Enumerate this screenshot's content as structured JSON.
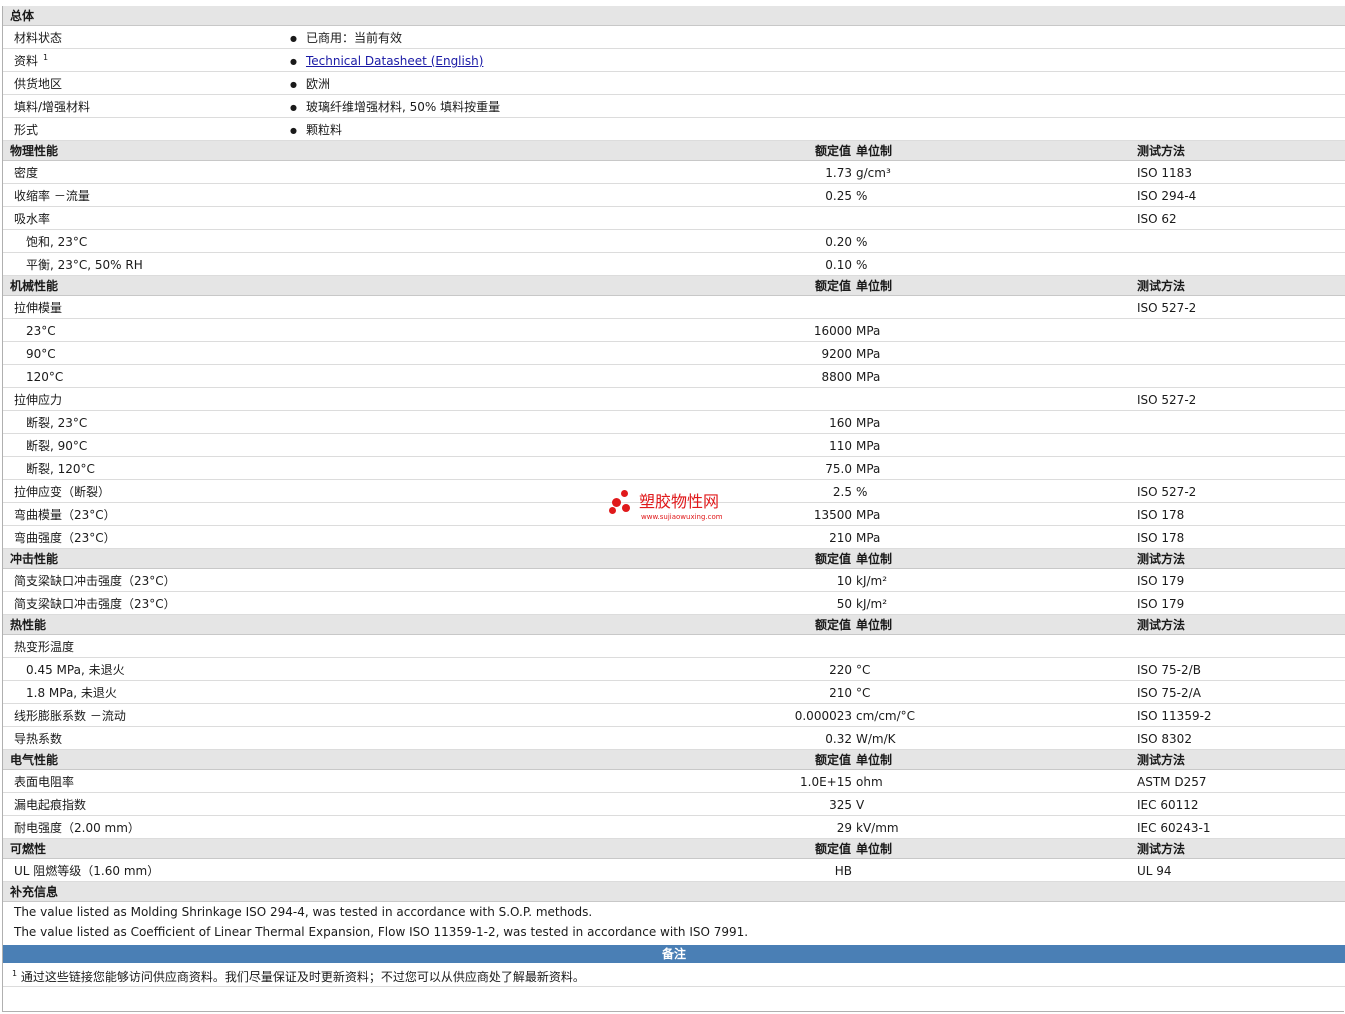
{
  "general": {
    "title": "总体",
    "rows": [
      {
        "label": "材料状态",
        "value": "已商用：当前有效"
      },
      {
        "label": "资料",
        "sup": "1",
        "value": "Technical Datasheet (English)",
        "is_link": true
      },
      {
        "label": "供货地区",
        "value": "欧洲"
      },
      {
        "label": "填料/增强材料",
        "value": "玻璃纤维增强材料, 50% 填料按重量"
      },
      {
        "label": "形式",
        "value": "颗粒料"
      }
    ]
  },
  "column_headers": {
    "value": "额定值",
    "unit": "单位制",
    "method": "测试方法"
  },
  "sections": [
    {
      "title": "物理性能",
      "rows": [
        {
          "label": "密度",
          "value": "1.73",
          "unit": "g/cm³",
          "method": "ISO 1183"
        },
        {
          "label": "收缩率 －流量",
          "value": "0.25",
          "unit": "%",
          "method": "ISO 294-4"
        },
        {
          "label": "吸水率",
          "method": "ISO 62"
        },
        {
          "label": "饱和, 23°C",
          "sub": true,
          "value": "0.20",
          "unit": "%"
        },
        {
          "label": "平衡, 23°C, 50% RH",
          "sub": true,
          "value": "0.10",
          "unit": "%"
        }
      ]
    },
    {
      "title": "机械性能",
      "rows": [
        {
          "label": "拉伸模量",
          "method": "ISO 527-2"
        },
        {
          "label": "23°C",
          "sub": true,
          "value": "16000",
          "unit": "MPa"
        },
        {
          "label": "90°C",
          "sub": true,
          "value": "9200",
          "unit": "MPa"
        },
        {
          "label": "120°C",
          "sub": true,
          "value": "8800",
          "unit": "MPa"
        },
        {
          "label": "拉伸应力",
          "method": "ISO 527-2"
        },
        {
          "label": "断裂, 23°C",
          "sub": true,
          "value": "160",
          "unit": "MPa"
        },
        {
          "label": "断裂, 90°C",
          "sub": true,
          "value": "110",
          "unit": "MPa"
        },
        {
          "label": "断裂, 120°C",
          "sub": true,
          "value": "75.0",
          "unit": "MPa"
        },
        {
          "label": "拉伸应变（断裂）",
          "value": "2.5",
          "unit": "%",
          "method": "ISO 527-2"
        },
        {
          "label": "弯曲模量（23°C）",
          "value": "13500",
          "unit": "MPa",
          "method": "ISO 178"
        },
        {
          "label": "弯曲强度（23°C）",
          "value": "210",
          "unit": "MPa",
          "method": "ISO 178"
        }
      ]
    },
    {
      "title": "冲击性能",
      "rows": [
        {
          "label": "简支梁缺口冲击强度（23°C）",
          "value": "10",
          "unit": "kJ/m²",
          "method": "ISO 179"
        },
        {
          "label": "简支梁缺口冲击强度（23°C）",
          "value": "50",
          "unit": "kJ/m²",
          "method": "ISO 179"
        }
      ]
    },
    {
      "title": "热性能",
      "rows": [
        {
          "label": "热变形温度"
        },
        {
          "label": "0.45 MPa, 未退火",
          "sub": true,
          "value": "220",
          "unit": "°C",
          "method": "ISO 75-2/B"
        },
        {
          "label": "1.8 MPa, 未退火",
          "sub": true,
          "value": "210",
          "unit": "°C",
          "method": "ISO 75-2/A"
        },
        {
          "label": "线形膨胀系数 －流动",
          "value": "0.000023",
          "unit": "cm/cm/°C",
          "method": "ISO 11359-2"
        },
        {
          "label": "导热系数",
          "value": "0.32",
          "unit": "W/m/K",
          "method": "ISO 8302"
        }
      ]
    },
    {
      "title": "电气性能",
      "rows": [
        {
          "label": "表面电阻率",
          "value": "1.0E+15",
          "unit": "ohm",
          "method": "ASTM D257"
        },
        {
          "label": "漏电起痕指数",
          "value": "325",
          "unit": "V",
          "method": "IEC 60112"
        },
        {
          "label": "耐电强度（2.00 mm）",
          "value": "29",
          "unit": "kV/mm",
          "method": "IEC 60243-1"
        }
      ]
    },
    {
      "title": "可燃性",
      "rows": [
        {
          "label": "UL 阻燃等级（1.60 mm）",
          "value": "HB",
          "method": "UL 94"
        }
      ]
    }
  ],
  "supplementary": {
    "title": "补充信息",
    "notes": [
      "The value listed as Molding Shrinkage ISO 294-4, was tested in accordance with S.O.P. methods.",
      "The value listed as Coefficient of Linear Thermal Expansion, Flow ISO 11359-1-2, was tested in accordance with ISO 7991."
    ]
  },
  "remarks": {
    "title": "备注",
    "sup": "1",
    "text": "通过这些链接您能够访问供应商资料。我们尽量保证及时更新资料；不过您可以从供应商处了解最新资料。"
  },
  "watermark": {
    "name": "塑胶物性网",
    "url": "www.sujiaowuxing.com",
    "color": "#e0191b"
  },
  "colors": {
    "section_bg": "#e5e5e5",
    "remarks_bar": "#4a7fb5",
    "link": "#1a1aa6"
  }
}
